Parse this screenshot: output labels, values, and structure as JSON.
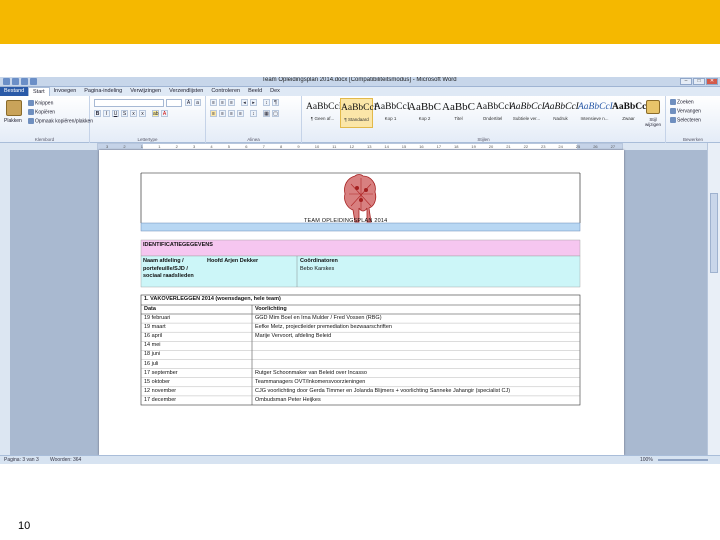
{
  "window": {
    "title": "Team Opleidingsplan 2014.docx [Compatibiliteitsmodus] - Microsoft Word",
    "buttons": [
      "–",
      "□",
      "✕"
    ]
  },
  "tabs": [
    "Bestand",
    "Start",
    "Invoegen",
    "Pagina-indeling",
    "Verwijzingen",
    "Verzendlijsten",
    "Controleren",
    "Beeld",
    "Dex"
  ],
  "active_tab": "Start",
  "ribbon": {
    "clipboard": {
      "paste": "Plakken",
      "cut": "Knippen",
      "copy": "Kopiëren",
      "format_painter": "Opmaak kopiëren/plakken",
      "label": "Klembord"
    },
    "font": {
      "label": "Lettertype"
    },
    "paragraph": {
      "label": "Alinea"
    },
    "styles": {
      "label": "Stijlen",
      "items": [
        {
          "sample": "AaBbCcI",
          "name": "¶ Geen af..."
        },
        {
          "sample": "AaBbCcI",
          "name": "¶ Standaard"
        },
        {
          "sample": "AaBbCcI",
          "name": "Kop 1"
        },
        {
          "sample": "AaBbC",
          "name": "Kop 2"
        },
        {
          "sample": "AaBbC",
          "name": "Titel"
        },
        {
          "sample": "AaBbCcI",
          "name": "Ondertitel"
        },
        {
          "sample": "AaBbCcI",
          "name": "Subtiele ver..."
        },
        {
          "sample": "AaBbCcI",
          "name": "Nadruk"
        },
        {
          "sample": "AaBbCcI",
          "name": "Intensieve n..."
        },
        {
          "sample": "AaBbCcI",
          "name": "Zwaar"
        }
      ],
      "change_styles": "Stijl wijzigen"
    },
    "editing": {
      "find": "Zoeken",
      "replace": "Vervangen",
      "select": "Selecteren",
      "label": "Bewerken"
    }
  },
  "ruler": {
    "ticks": [
      "3",
      "2",
      "1",
      "1",
      "2",
      "3",
      "4",
      "5",
      "6",
      "7",
      "8",
      "9",
      "10",
      "11",
      "12",
      "13",
      "14",
      "15",
      "16",
      "17",
      "18",
      "19",
      "20",
      "21",
      "22",
      "23",
      "24",
      "25",
      "26",
      "27"
    ]
  },
  "document": {
    "banner": "TEAM OPLEIDINGSPLAN 2014",
    "ident_header": "IDENTIFICATIEGEGEVENS",
    "ident_left_label": "Naam afdeling / portefeuille/SJD / sociaal raadslieden",
    "ident_left_value": "Hoofd Arjen Dekker",
    "ident_right_label": "Coördinatoren",
    "ident_right_value": "Bebo Karskes",
    "section_title": "1. VAKOVERLEGGEN 2014 (woensdagen, hele team)",
    "col_date": "Data",
    "col_info": "Voorlichting",
    "rows": [
      {
        "date": "19 februari",
        "info": "GGD Mim Boel en Irna Mulder / Fred Vossen (RBG)"
      },
      {
        "date": "19 maart",
        "info": "Eefke Metz, projectleider premediation bezwaarschriften"
      },
      {
        "date": "16 april",
        "info": "Marije Vervoort, afdeling Beleid"
      },
      {
        "date": "14 mei",
        "info": ""
      },
      {
        "date": "18 juni",
        "info": ""
      },
      {
        "date": "16 juli",
        "info": ""
      },
      {
        "date": "17 september",
        "info": "Rutger Schoonmaker van Beleid over Incasso"
      },
      {
        "date": "15 oktober",
        "info": "Teammanagers OVT/Inkomensvoorzieningen"
      },
      {
        "date": "12 november",
        "info": "CJG voorlichting door Gerda Timmer en Jolanda Blijmers + voorlichting Sanneke Jahangir (specialist CJ)"
      },
      {
        "date": "17 december",
        "info": "Ombudsman Peter Heijkes"
      }
    ]
  },
  "status": {
    "page": "Pagina: 3 van 3",
    "words": "Woorden: 364",
    "zoom": "100%"
  },
  "slide_number": "10",
  "colors": {
    "band": "#f5b800",
    "banner": "#b8d7f3",
    "ident_header": "#f6c6f0",
    "ident_body": "#ccf6f8"
  }
}
